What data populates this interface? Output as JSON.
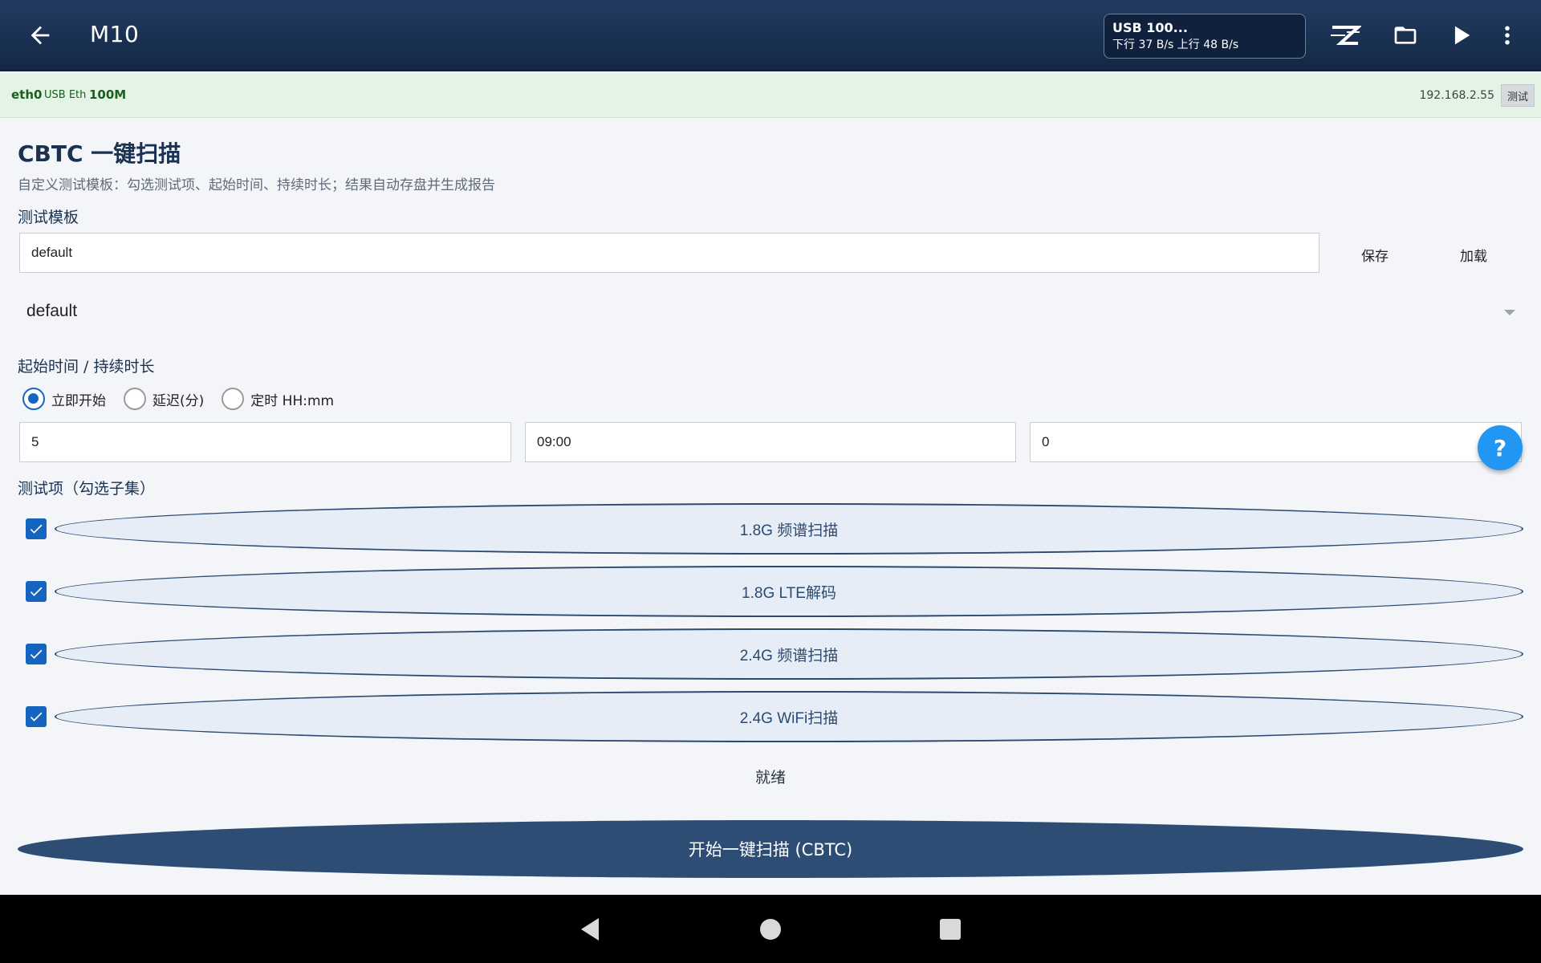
{
  "app_bar": {
    "title": "M10",
    "usb_status": {
      "title": "USB 100...",
      "rates": "下行 37 B/s 上行 48 B/s"
    },
    "icons": [
      "back-arrow-icon",
      "logo-z-icon",
      "folder-icon",
      "play-icon",
      "more-vert-icon"
    ]
  },
  "status_strip": {
    "interface": "eth0",
    "type": "USB Eth",
    "speed": "100M",
    "ip": "192.168.2.55",
    "test_label": "测试"
  },
  "page": {
    "title": "CBTC 一键扫描",
    "subtitle": "自定义测试模板：勾选测试项、起始时间、持续时长；结果自动存盘并生成报告"
  },
  "template": {
    "label": "测试模板",
    "name_value": "default",
    "save_label": "保存",
    "load_label": "加载",
    "selected": "default"
  },
  "timing": {
    "label": "起始时间 / 持续时长",
    "options": [
      {
        "label": "立即开始",
        "checked": true
      },
      {
        "label": "延迟(分)",
        "checked": false
      },
      {
        "label": "定时 HH:mm",
        "checked": false
      }
    ],
    "fields": [
      "5",
      "09:00",
      "0"
    ]
  },
  "help_label": "?",
  "tests": {
    "label": "测试项（勾选子集）",
    "items": [
      {
        "label": "1.8G 频谱扫描",
        "checked": true
      },
      {
        "label": "1.8G LTE解码",
        "checked": true
      },
      {
        "label": "2.4G 频谱扫描",
        "checked": true
      },
      {
        "label": "2.4G WiFi扫描",
        "checked": true
      }
    ]
  },
  "status_text": "就绪",
  "start_button": "开始一键扫描 (CBTC)",
  "colors": {
    "app_bar": "#1a3152",
    "status_strip": "#e3f3e5",
    "accent": "#1565c0",
    "pill_border": "#2c4a70",
    "start_button": "#2e4d75",
    "fab": "#2196f3"
  }
}
